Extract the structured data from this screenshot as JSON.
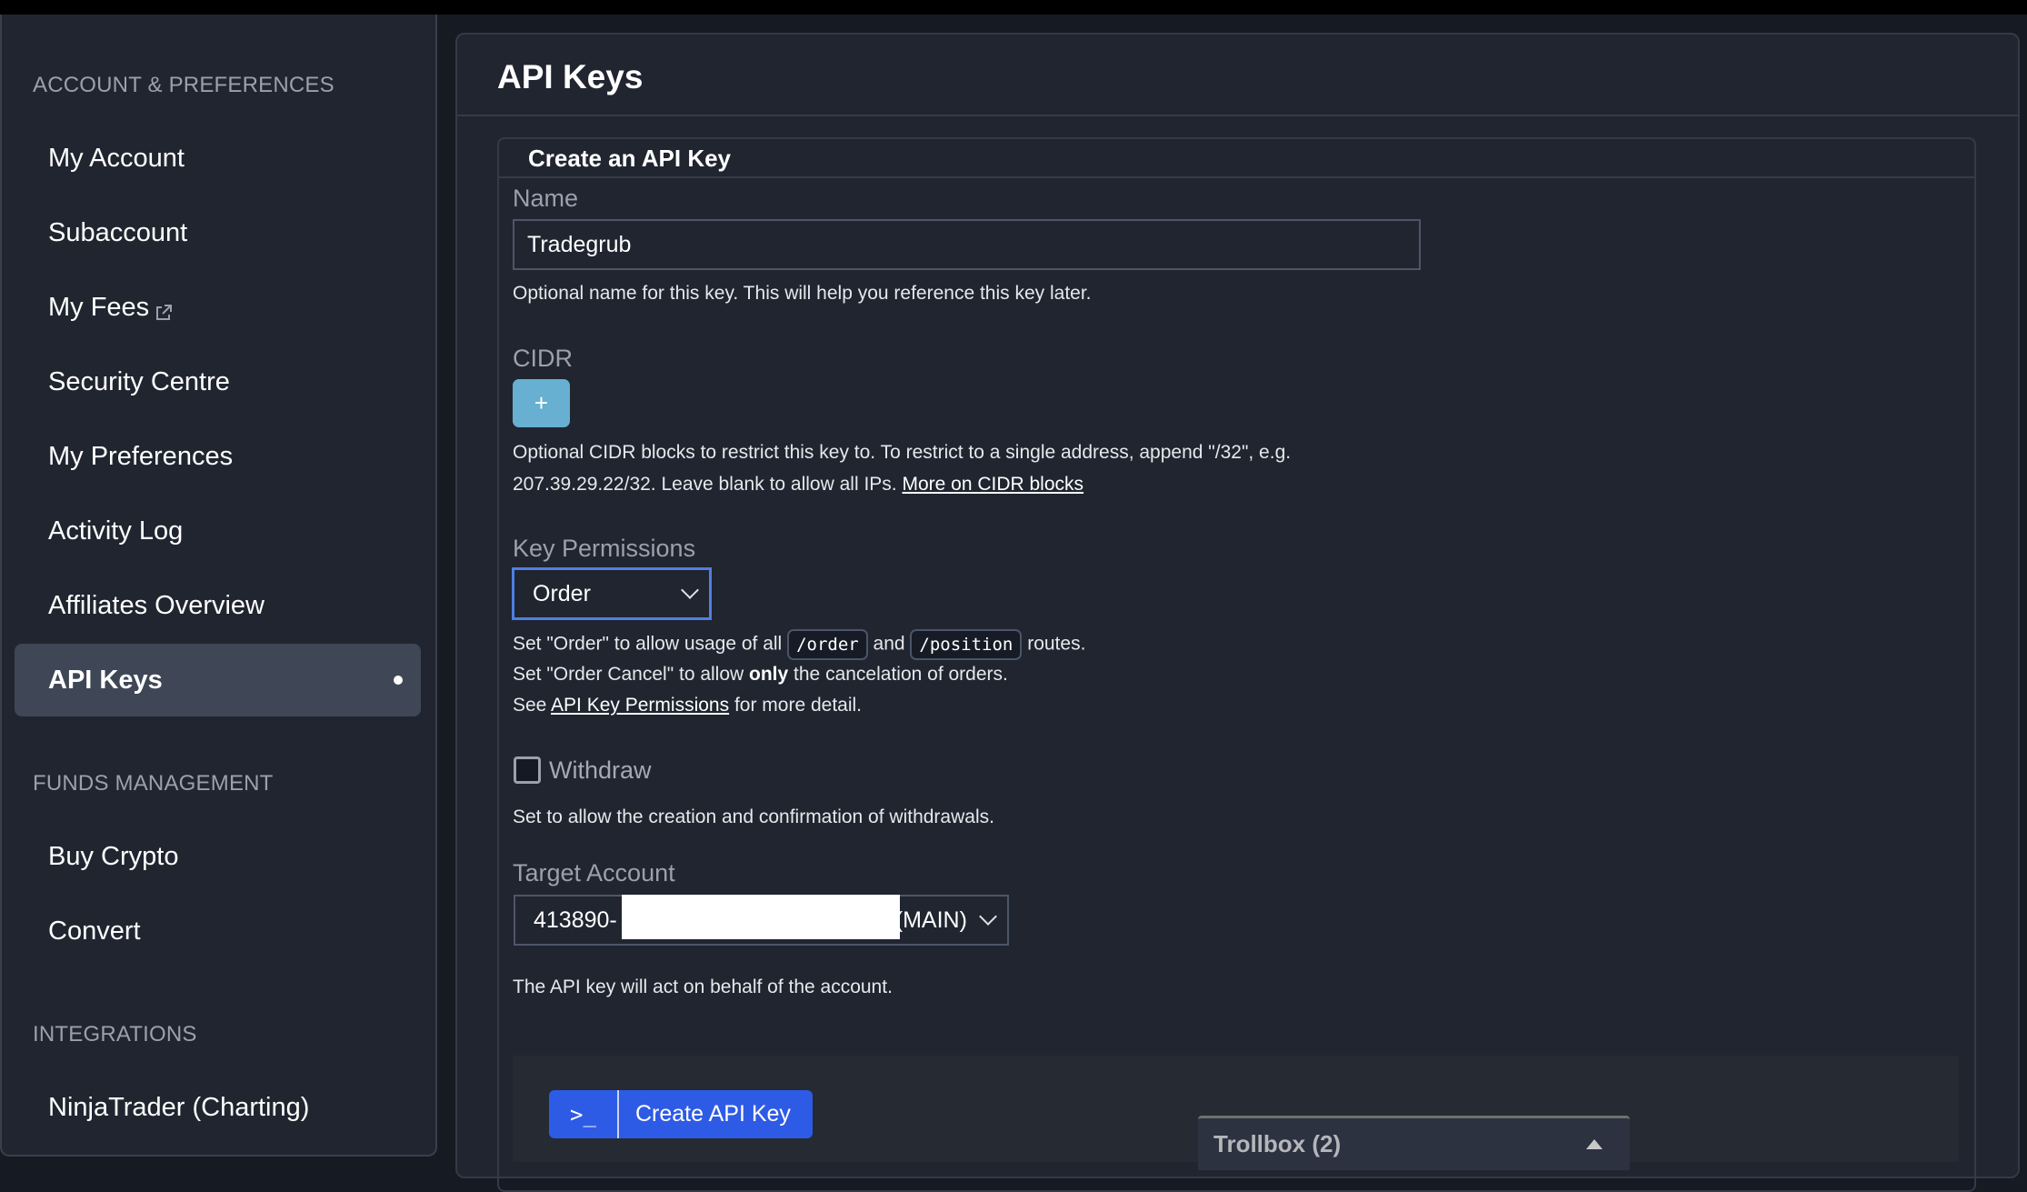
{
  "sidebar": {
    "sections": [
      {
        "title": "ACCOUNT & PREFERENCES",
        "items": [
          {
            "label": "My Account",
            "external": false,
            "active": false
          },
          {
            "label": "Subaccount",
            "external": false,
            "active": false
          },
          {
            "label": "My Fees",
            "external": true,
            "active": false
          },
          {
            "label": "Security Centre",
            "external": false,
            "active": false
          },
          {
            "label": "My Preferences",
            "external": false,
            "active": false
          },
          {
            "label": "Activity Log",
            "external": false,
            "active": false
          },
          {
            "label": "Affiliates Overview",
            "external": false,
            "active": false
          },
          {
            "label": "API Keys",
            "external": false,
            "active": true
          }
        ]
      },
      {
        "title": "FUNDS MANAGEMENT",
        "items": [
          {
            "label": "Buy Crypto",
            "external": false,
            "active": false
          },
          {
            "label": "Convert",
            "external": false,
            "active": false
          }
        ]
      },
      {
        "title": "INTEGRATIONS",
        "items": [
          {
            "label": "NinjaTrader (Charting)",
            "external": false,
            "active": false
          }
        ]
      }
    ]
  },
  "main": {
    "title": "API Keys",
    "card": {
      "title": "Create an API Key",
      "name": {
        "label": "Name",
        "value": "Tradegrub",
        "help": "Optional name for this key. This will help you reference this key later."
      },
      "cidr": {
        "label": "CIDR",
        "add_label": "+",
        "help_line1": "Optional CIDR blocks to restrict this key to. To restrict to a single address, append \"/32\", e.g.",
        "help_line2": "207.39.29.22/32. Leave blank to allow all IPs. ",
        "help_link": "More on CIDR blocks"
      },
      "permissions": {
        "label": "Key Permissions",
        "selected": "Order",
        "line1_a": "Set \"Order\" to allow usage of all ",
        "line1_code1": "/order",
        "line1_b": " and ",
        "line1_code2": "/position",
        "line1_c": " routes.",
        "line2_a": "Set \"Order Cancel\" to allow ",
        "line2_bold": "only",
        "line2_b": " the cancelation of orders.",
        "line3_a": "See ",
        "line3_link": "API Key Permissions",
        "line3_b": " for more detail."
      },
      "withdraw": {
        "label": "Withdraw",
        "checked": false,
        "help": "Set to allow the creation and confirmation of withdrawals."
      },
      "target_account": {
        "label": "Target Account",
        "value_prefix": "413890-",
        "value_suffix": "(MAIN)",
        "help": "The API key will act on behalf of the account."
      },
      "submit": {
        "icon": "terminal-icon",
        "icon_glyph": ">_",
        "label": "Create API Key"
      }
    }
  },
  "trollbox": {
    "label": "Trollbox (2)"
  },
  "colors": {
    "primary_button": "#2e5be6",
    "add_button": "#67b0d1",
    "focus_ring": "#4f7fe0",
    "active_nav": "#3f4756"
  }
}
